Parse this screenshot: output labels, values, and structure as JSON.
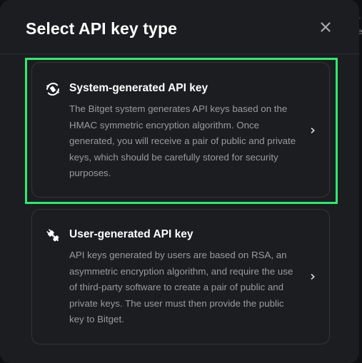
{
  "modal": {
    "title": "Select API key type"
  },
  "options": [
    {
      "title": "System-generated API key",
      "description": "The Bitget system generates API keys based on the HMAC symmetric encryption algorithm. Once generated, you will receive a pair of public and private keys, which should be carefully stored for security purposes.",
      "icon": "refresh-key-icon",
      "selected": true
    },
    {
      "title": "User-generated API key",
      "description": "API keys generated by users are based on RSA, an asymmetric encryption algorithm, and require the use of third-party software to create a pair of public and private keys. The user must then provide the public key to Bitget.",
      "icon": "plug-icon",
      "selected": false
    }
  ],
  "colors": {
    "highlight": "#2dea6e",
    "modal_bg": "#1c1d20",
    "text_primary": "#ffffff",
    "text_secondary": "#9a9ba0"
  }
}
